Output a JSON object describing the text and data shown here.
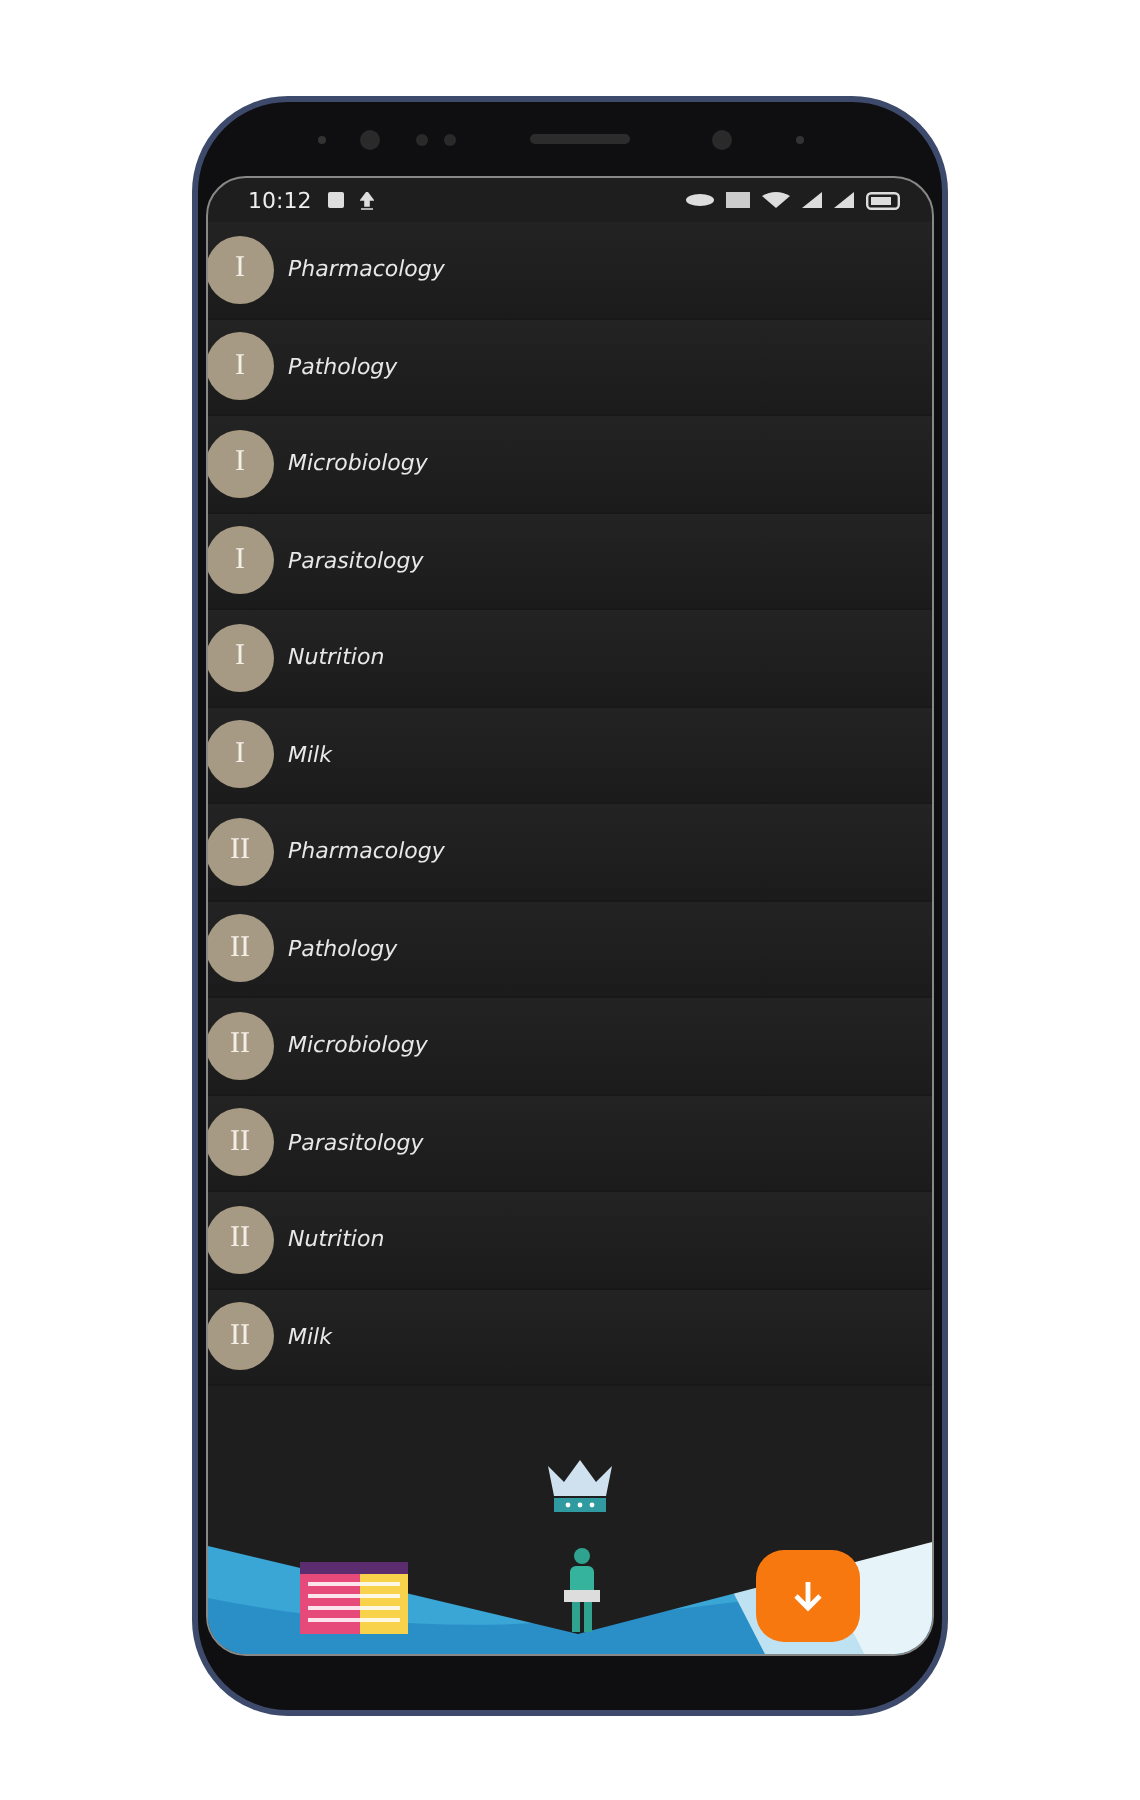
{
  "status_bar": {
    "time": "10:12"
  },
  "items": [
    {
      "badge": "I",
      "label": "Pharmacology"
    },
    {
      "badge": "I",
      "label": "Pathology"
    },
    {
      "badge": "I",
      "label": "Microbiology"
    },
    {
      "badge": "I",
      "label": "Parasitology"
    },
    {
      "badge": "I",
      "label": "Nutrition"
    },
    {
      "badge": "I",
      "label": "Milk"
    },
    {
      "badge": "II",
      "label": "Pharmacology"
    },
    {
      "badge": "II",
      "label": "Pathology"
    },
    {
      "badge": "II",
      "label": "Microbiology"
    },
    {
      "badge": "II",
      "label": "Parasitology"
    },
    {
      "badge": "II",
      "label": "Nutrition"
    },
    {
      "badge": "II",
      "label": "Milk"
    }
  ]
}
